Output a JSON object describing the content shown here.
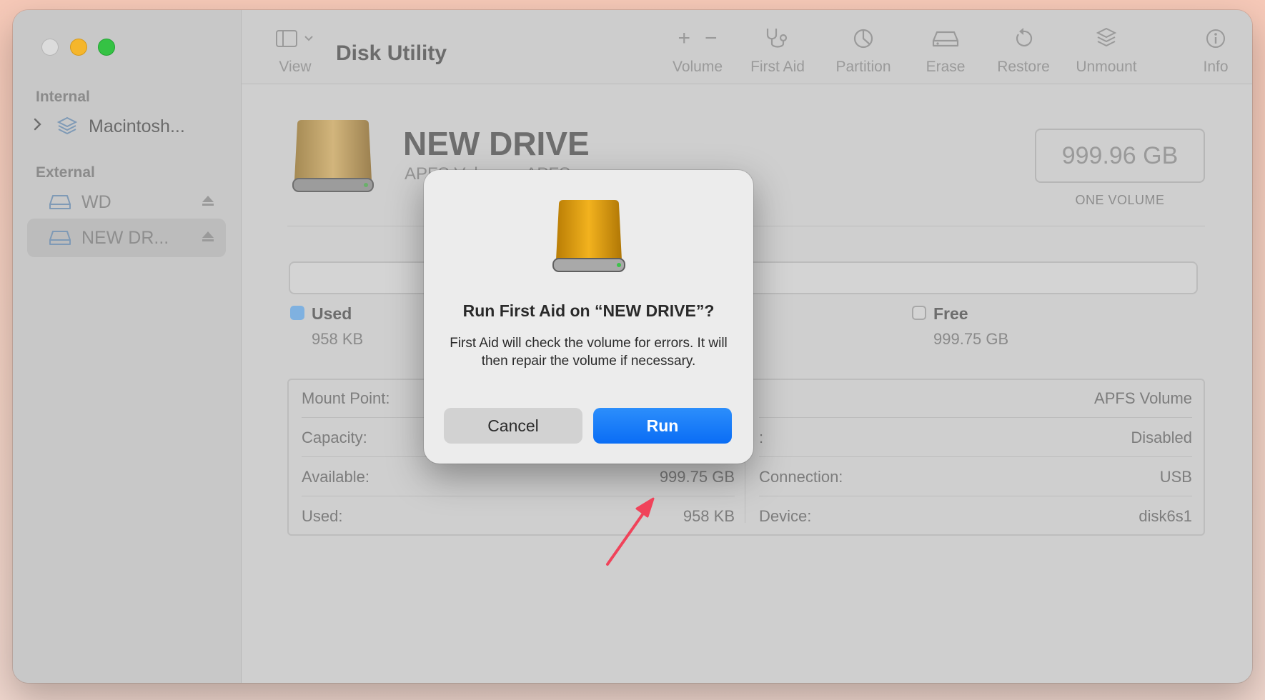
{
  "window": {
    "title": "Disk Utility"
  },
  "sidebar": {
    "internal_label": "Internal",
    "external_label": "External",
    "items": [
      {
        "label": "Macintosh..."
      },
      {
        "label": "WD"
      },
      {
        "label": "NEW DR..."
      }
    ]
  },
  "toolbar": {
    "view_label": "View",
    "volume_label": "Volume",
    "first_aid_label": "First Aid",
    "partition_label": "Partition",
    "erase_label": "Erase",
    "restore_label": "Restore",
    "unmount_label": "Unmount",
    "info_label": "Info",
    "add_glyph": "+",
    "remove_glyph": "−"
  },
  "drive": {
    "name": "NEW DRIVE",
    "subtitle": "APFS Volume · APFS",
    "size": "999.96 GB",
    "size_caption": "ONE VOLUME"
  },
  "usage": {
    "used_label": "Used",
    "used_value": "958 KB",
    "free_label": "Free",
    "free_value": "999.75 GB"
  },
  "info": {
    "left": [
      {
        "key": "Mount Point:",
        "value": ""
      },
      {
        "key": "Capacity:",
        "value": ""
      },
      {
        "key": "Available:",
        "value": "999.75 GB"
      },
      {
        "key": "Used:",
        "value": "958 KB"
      }
    ],
    "right": [
      {
        "key": "",
        "value": "APFS Volume"
      },
      {
        "key": ":",
        "value": "Disabled"
      },
      {
        "key": "Connection:",
        "value": "USB"
      },
      {
        "key": "Device:",
        "value": "disk6s1"
      }
    ]
  },
  "dialog": {
    "title": "Run First Aid on “NEW DRIVE”?",
    "message": "First Aid will check the volume for errors. It will then repair the volume if necessary.",
    "cancel_label": "Cancel",
    "run_label": "Run"
  },
  "colors": {
    "accent": "#0a6df5",
    "used_swatch": "#7fb1e0",
    "arrow": "#f0435a"
  }
}
